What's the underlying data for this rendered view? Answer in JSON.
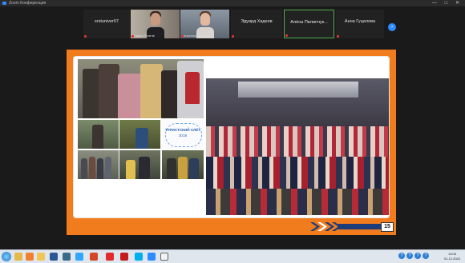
{
  "window": {
    "title": "Zoom Конференция",
    "controls": "— □ ✕"
  },
  "participants": [
    {
      "name": "srstuniver07",
      "caption": "",
      "video": false,
      "selected": false
    },
    {
      "name": "",
      "caption": "Павел Рогатов",
      "video": true,
      "selected": false
    },
    {
      "name": "",
      "caption": "Анастасия Богдан...",
      "video": true,
      "selected": false
    },
    {
      "name": "Эдуард Хадеев",
      "caption": "",
      "video": false,
      "selected": false
    },
    {
      "name": "Алёна Пилипчук...",
      "caption": "",
      "video": false,
      "selected": true
    },
    {
      "name": "Анна Гуцалова",
      "caption": "",
      "video": false,
      "selected": false
    }
  ],
  "next_arrow": "›",
  "slide": {
    "logo_text": "ТУРИСТСКИЙ СЛЁТ",
    "logo_year": "2018",
    "page_number": "15",
    "colors": {
      "frame": "#f07c1d",
      "navy": "#1d3d7a"
    }
  },
  "taskbar": {
    "apps": [
      "explorer-icon",
      "media-icon",
      "folder-icon",
      "word-icon",
      "photoshop-icon",
      "powerpoint-icon",
      "yandex-icon",
      "acrobat-icon",
      "skype-icon",
      "zoom-icon",
      "window-icon"
    ],
    "tray": [
      "?",
      "?",
      "?",
      "?"
    ],
    "clock_time": "13:05",
    "clock_date": "01.12.2020"
  }
}
